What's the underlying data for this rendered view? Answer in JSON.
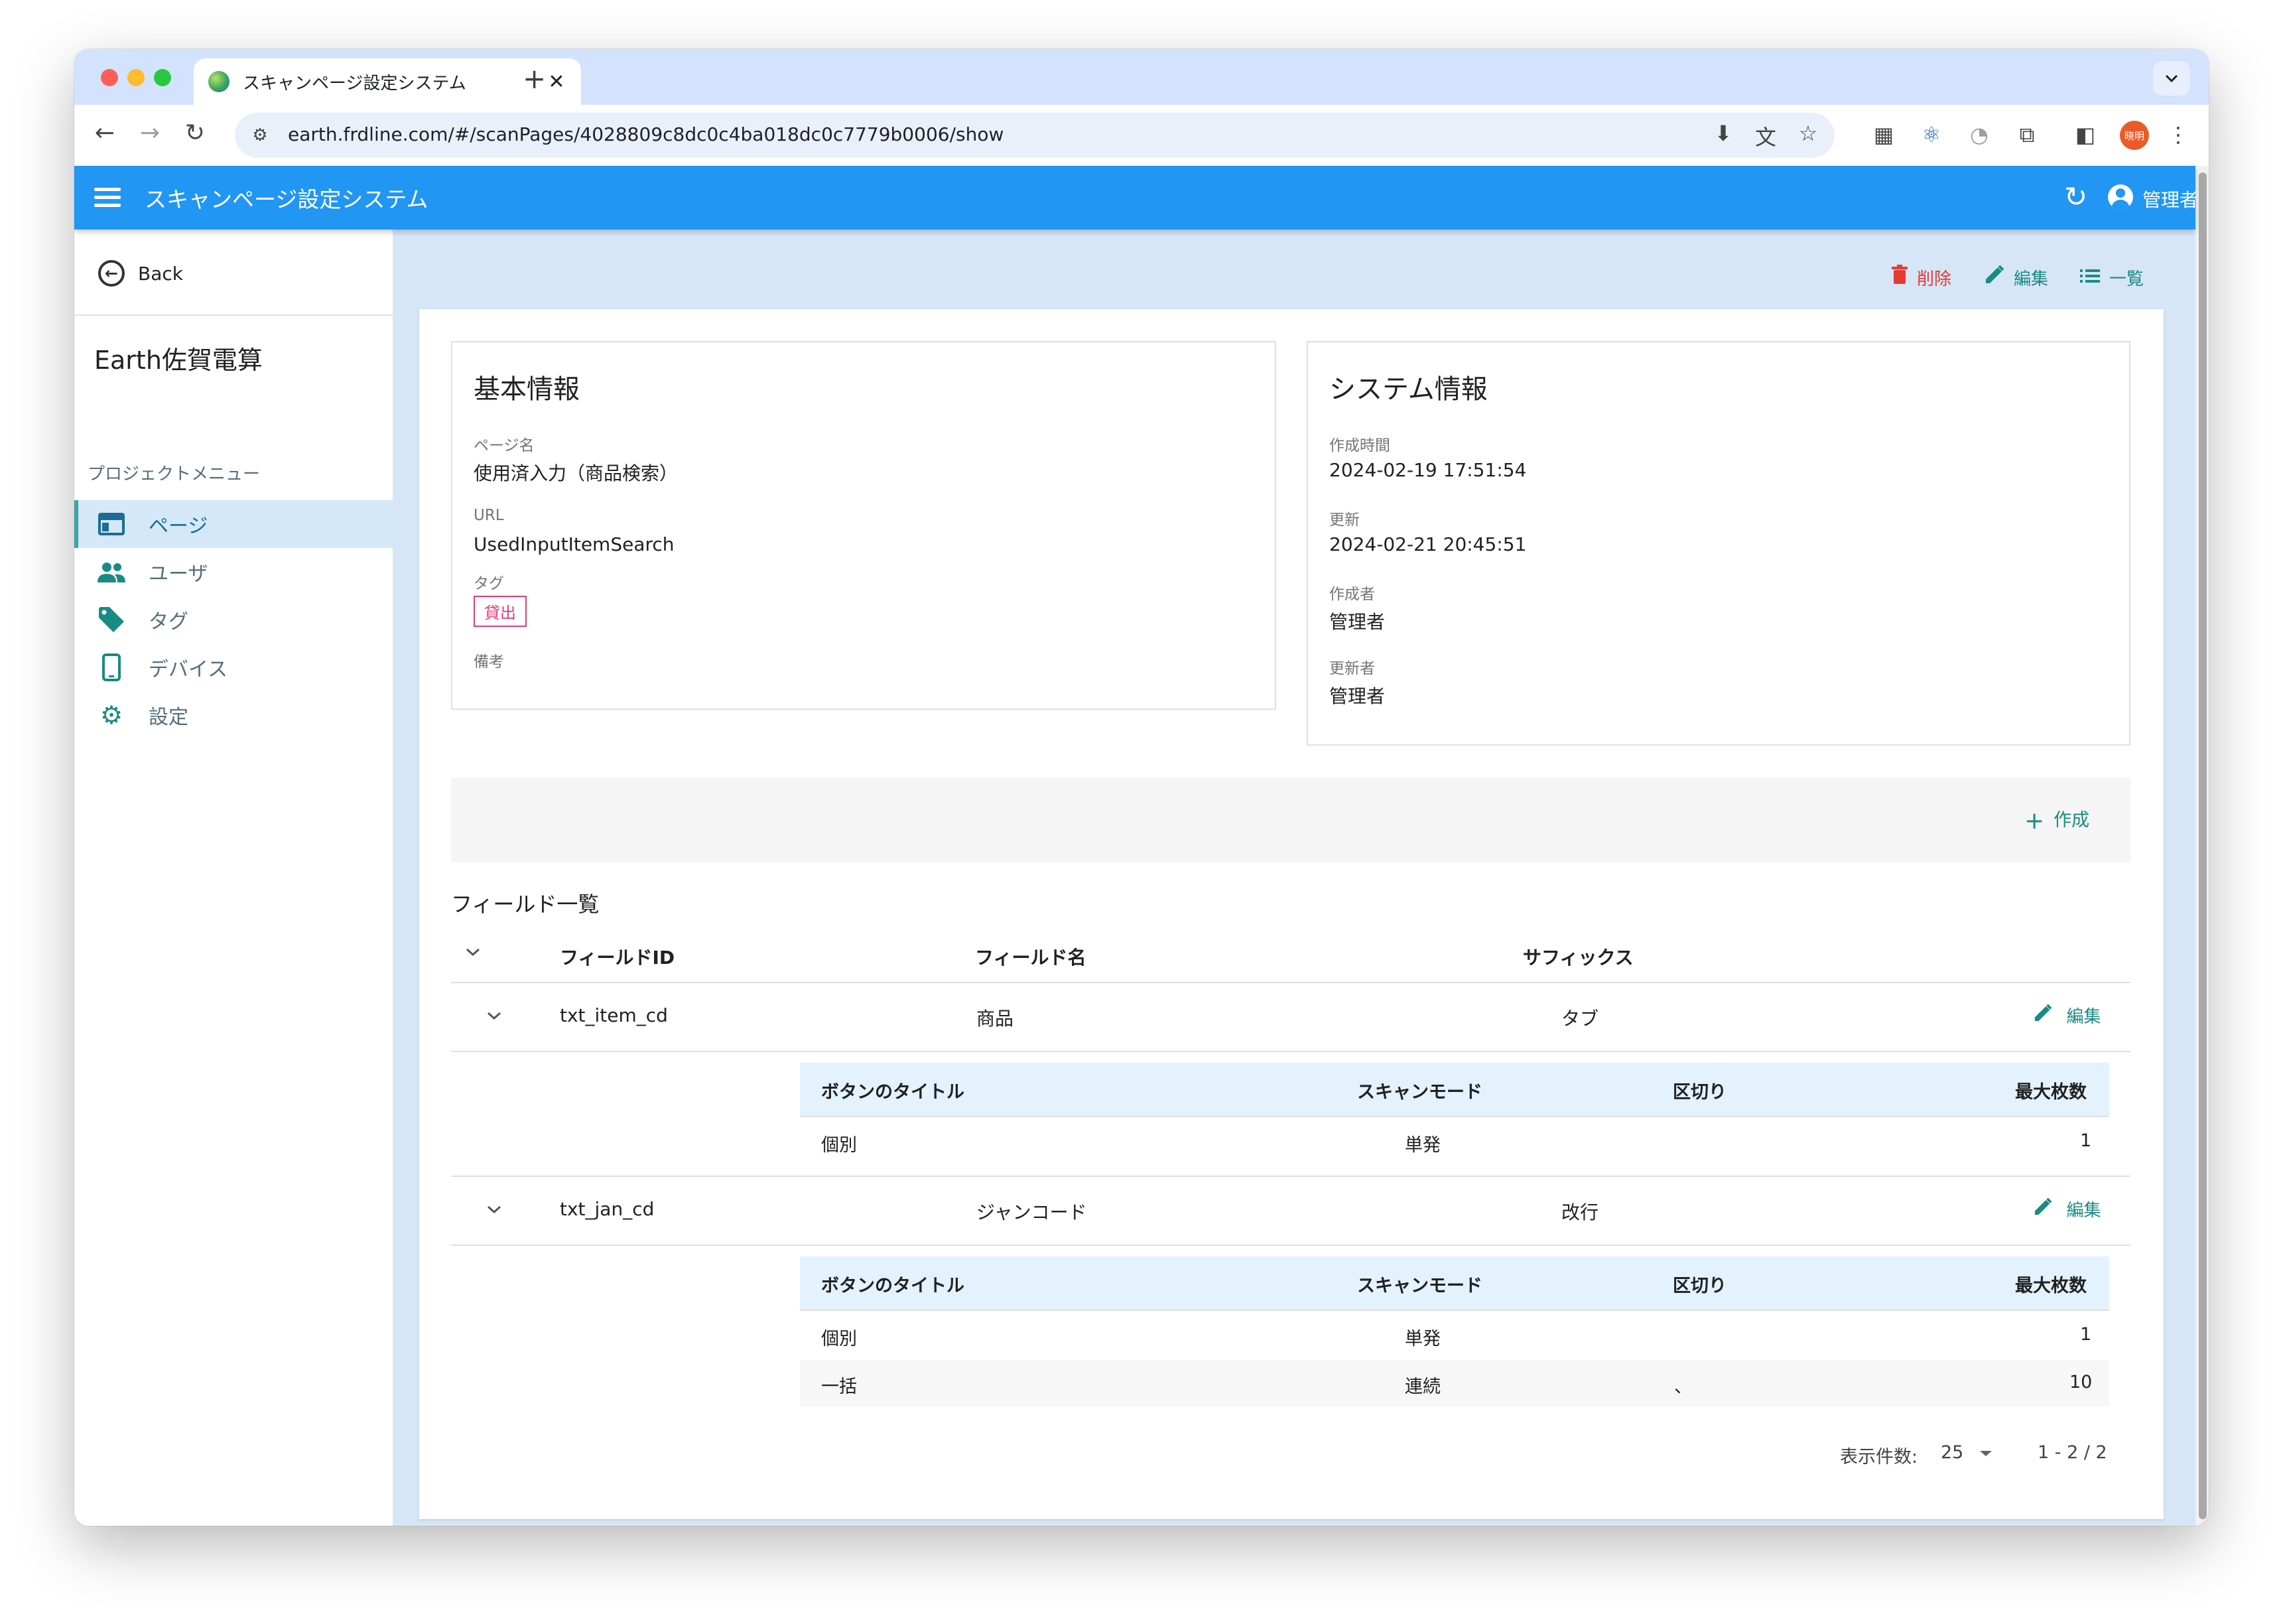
{
  "browser": {
    "tab_title": "スキャンページ設定システム",
    "tab_close": "✕",
    "new_tab": "+",
    "url": "earth.frdline.com/#/scanPages/4028809c8dc0c4ba018dc0c7779b0006/show",
    "profile_label": "晓明"
  },
  "appbar": {
    "title": "スキャンページ設定システム",
    "user": "管理者"
  },
  "sidebar": {
    "back_label": "Back",
    "project_name": "Earth佐賀電算",
    "menu_label": "プロジェクトメニュー",
    "items": [
      {
        "label": "ページ",
        "icon": "web-icon",
        "active": true
      },
      {
        "label": "ユーザ",
        "icon": "people-icon",
        "active": false
      },
      {
        "label": "タグ",
        "icon": "tag-icon",
        "active": false
      },
      {
        "label": "デバイス",
        "icon": "phone-icon",
        "active": false
      },
      {
        "label": "設定",
        "icon": "gear-icon",
        "active": false
      }
    ]
  },
  "actions": {
    "delete": "削除",
    "edit": "編集",
    "list": "一覧"
  },
  "basic_info": {
    "title": "基本情報",
    "page_name_label": "ページ名",
    "page_name": "使用済入力（商品検索）",
    "url_label": "URL",
    "url_value": "UsedInputItemSearch",
    "tag_label": "タグ",
    "tag_value": "貸出",
    "remarks_label": "備考"
  },
  "system_info": {
    "title": "システム情報",
    "created_label": "作成時間",
    "created": "2024-02-19 17:51:54",
    "updated_label": "更新",
    "updated": "2024-02-21 20:45:51",
    "creator_label": "作成者",
    "creator": "管理者",
    "updater_label": "更新者",
    "updater": "管理者"
  },
  "fields": {
    "create_label": "作成",
    "list_title": "フィールド一覧",
    "headers": {
      "id": "フィールドID",
      "name": "フィールド名",
      "suffix": "サフィックス"
    },
    "edit_label": "編集",
    "sub_headers": {
      "title": "ボタンのタイトル",
      "mode": "スキャンモード",
      "sep": "区切り",
      "max": "最大枚数"
    },
    "rows": [
      {
        "id": "txt_item_cd",
        "name": "商品",
        "suffix": "タブ",
        "buttons": [
          {
            "title": "個別",
            "mode": "単発",
            "sep": "",
            "max": "1"
          }
        ]
      },
      {
        "id": "txt_jan_cd",
        "name": "ジャンコード",
        "suffix": "改行",
        "buttons": [
          {
            "title": "個別",
            "mode": "単発",
            "sep": "",
            "max": "1"
          },
          {
            "title": "一括",
            "mode": "連続",
            "sep": "、",
            "max": "10"
          }
        ]
      }
    ]
  },
  "pagination": {
    "per_page_label": "表示件数:",
    "per_page": "25",
    "range": "1 - 2 / 2"
  },
  "colors": {
    "appbar": "#2196f3",
    "accent": "#1a8a84",
    "danger": "#e53935",
    "tag": "#e53977"
  }
}
